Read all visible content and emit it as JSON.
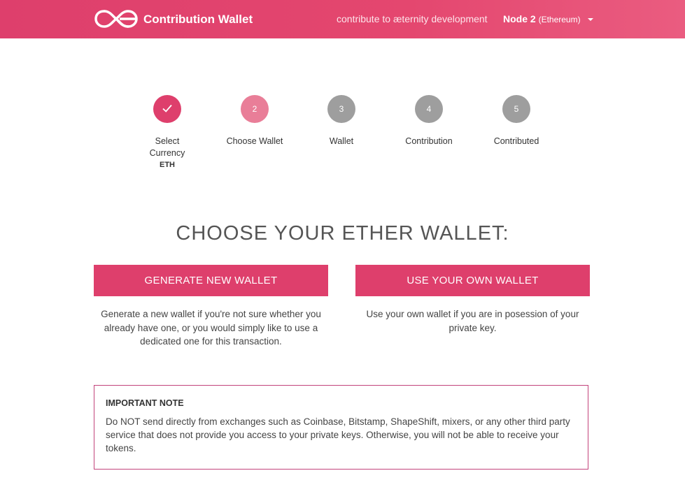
{
  "header": {
    "brand": "Contribution Wallet",
    "tagline": "contribute to æternity development",
    "node_label": "Node 2",
    "node_network": "(Ethereum)",
    "logo_icon": "aeternity-logo-icon"
  },
  "steps": [
    {
      "number": "",
      "label_line1": "Select",
      "label_line2": "Currency",
      "sub": "ETH",
      "state": "done"
    },
    {
      "number": "2",
      "label_line1": "Choose Wallet",
      "label_line2": "",
      "sub": "",
      "state": "active"
    },
    {
      "number": "3",
      "label_line1": "Wallet",
      "label_line2": "",
      "sub": "",
      "state": "todo"
    },
    {
      "number": "4",
      "label_line1": "Contribution",
      "label_line2": "",
      "sub": "",
      "state": "todo"
    },
    {
      "number": "5",
      "label_line1": "Contributed",
      "label_line2": "",
      "sub": "",
      "state": "todo"
    }
  ],
  "main": {
    "title": "CHOOSE YOUR ETHER WALLET:",
    "generate_button": "GENERATE NEW WALLET",
    "generate_desc": "Generate a new wallet if you're not sure whether you already have one, or you would simply like to use a dedicated one for this transaction.",
    "own_button": "USE YOUR OWN WALLET",
    "own_desc": "Use your own wallet if you are in posession of your private key."
  },
  "note": {
    "title": "IMPORTANT NOTE",
    "body": "Do NOT send directly from exchanges such as Coinbase, Bitstamp, ShapeShift, mixers, or any other third party service that does not provide you access to your private keys. Otherwise, you will not be able to receive your tokens."
  },
  "colors": {
    "accent": "#de3f6c",
    "active_step": "#e97e98",
    "inactive_step": "#9e9e9e",
    "note_border": "#c2437b"
  }
}
